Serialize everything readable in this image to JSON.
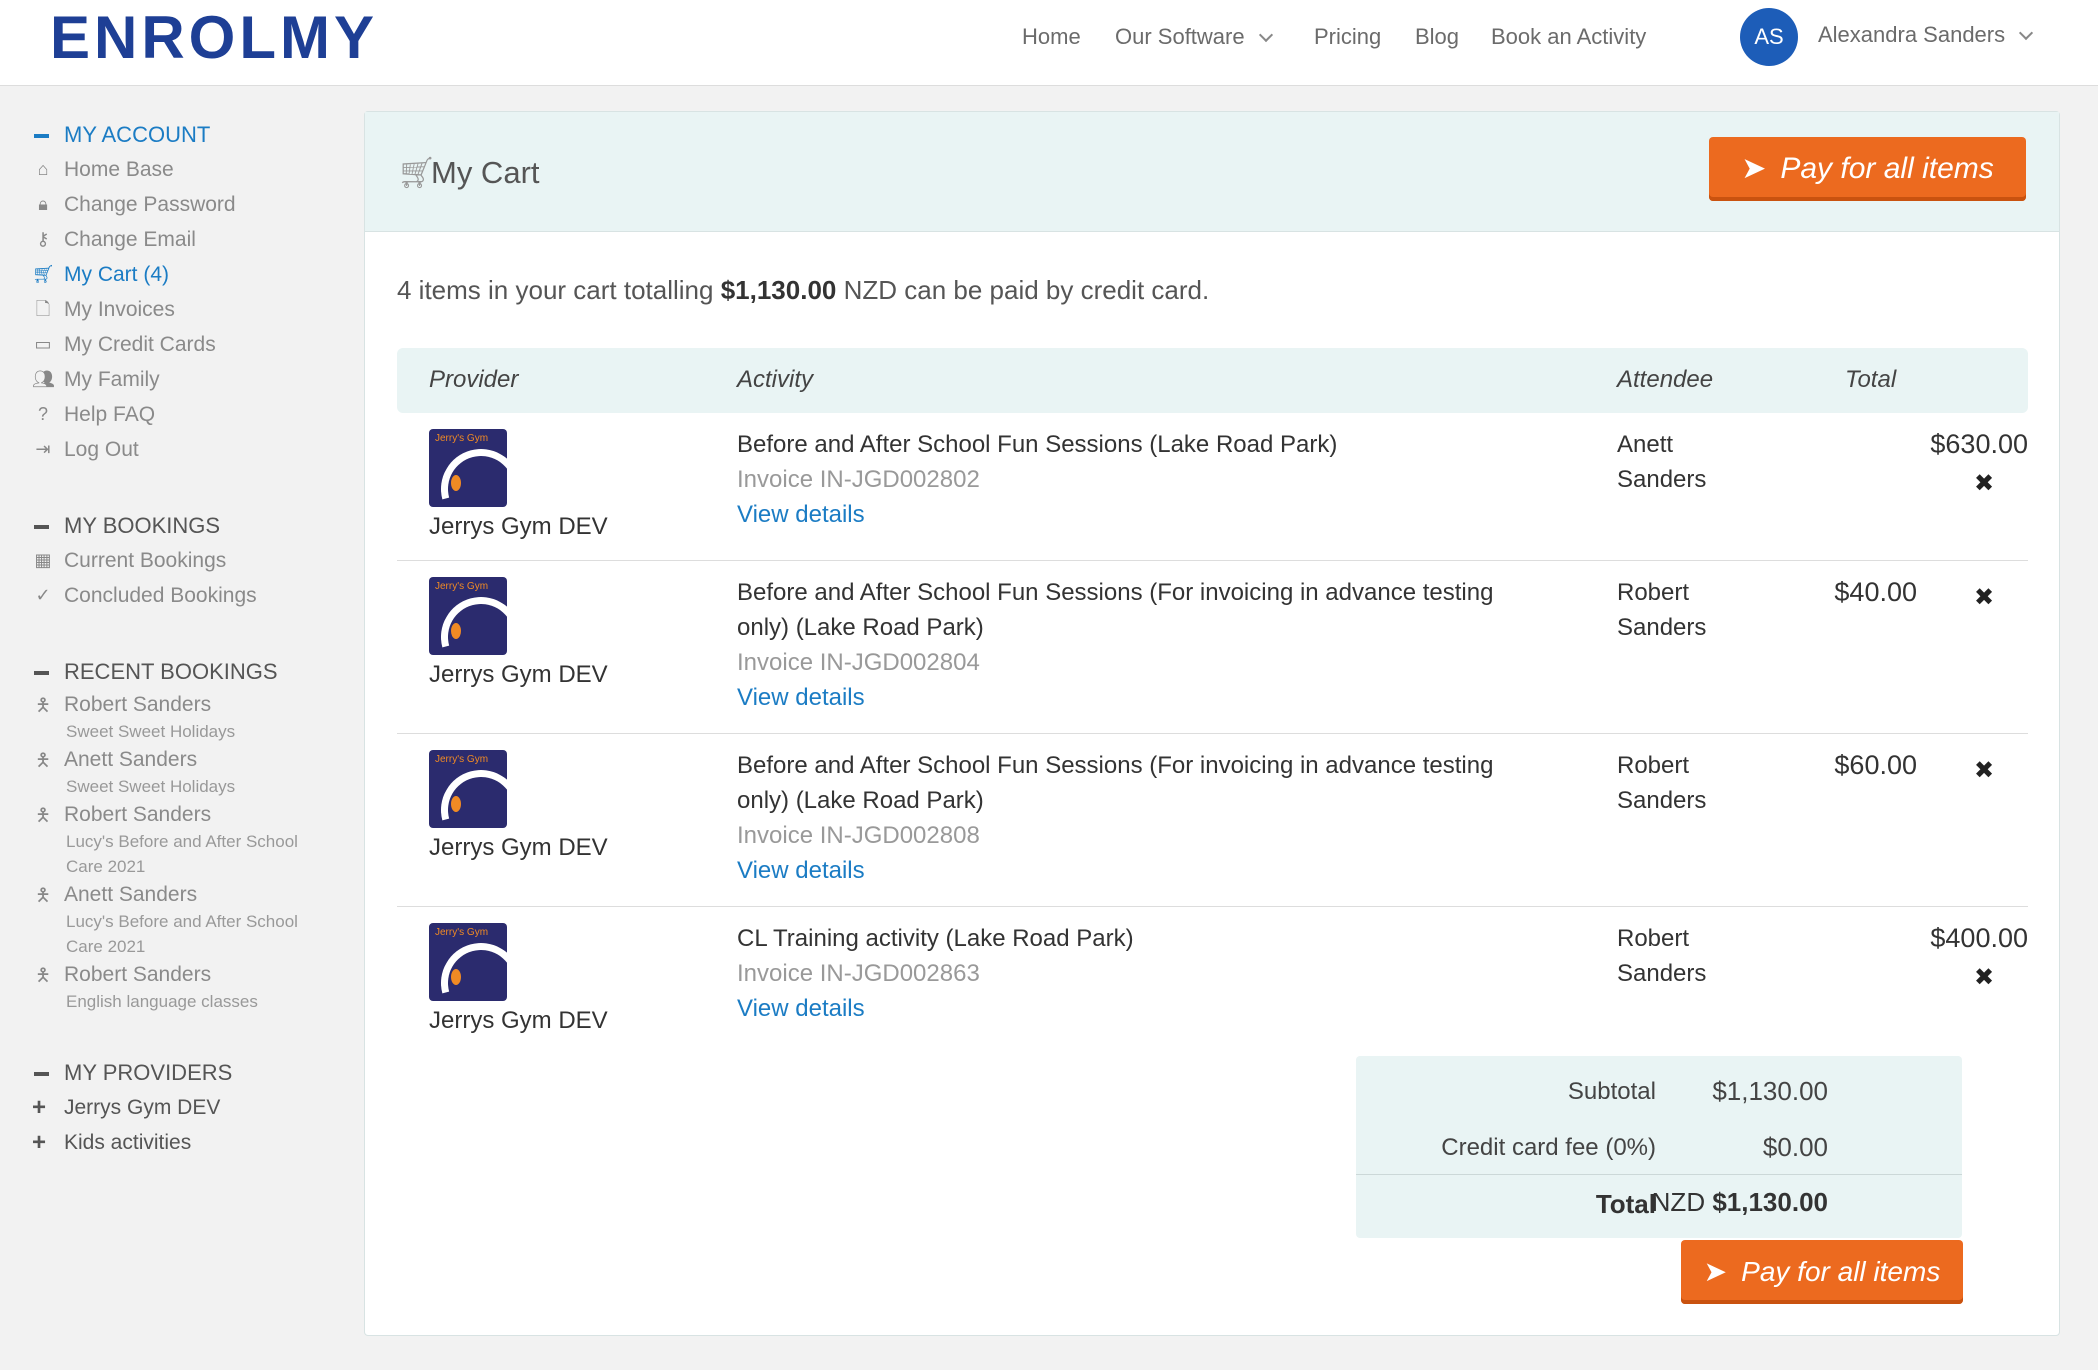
{
  "brand": {
    "logo_text": "ENROLMY"
  },
  "nav": {
    "items": [
      "Home",
      "Our Software",
      "Pricing",
      "Blog",
      "Book an Activity"
    ],
    "user_initials": "AS",
    "user_name": "Alexandra Sanders"
  },
  "sidebar": {
    "account_heading": "MY ACCOUNT",
    "account_items": [
      {
        "label": "Home Base",
        "icon": "home-icon"
      },
      {
        "label": "Change Password",
        "icon": "lock-icon"
      },
      {
        "label": "Change Email",
        "icon": "key-icon"
      },
      {
        "label": "My Cart (4)",
        "icon": "cart-icon"
      },
      {
        "label": "My Invoices",
        "icon": "file-icon"
      },
      {
        "label": "My Credit Cards",
        "icon": "credit-card-icon"
      },
      {
        "label": "My Family",
        "icon": "users-icon"
      },
      {
        "label": "Help FAQ",
        "icon": "question-icon"
      },
      {
        "label": "Log Out",
        "icon": "logout-icon"
      }
    ],
    "bookings_heading": "MY BOOKINGS",
    "bookings_items": [
      {
        "label": "Current Bookings",
        "icon": "calendar-icon"
      },
      {
        "label": "Concluded Bookings",
        "icon": "check-circle-icon"
      }
    ],
    "recent_heading": "RECENT BOOKINGS",
    "recent_items": [
      {
        "name": "Robert Sanders",
        "activity": "Sweet Sweet Holidays"
      },
      {
        "name": "Anett Sanders",
        "activity": "Sweet Sweet Holidays"
      },
      {
        "name": "Robert Sanders",
        "activity": "Lucy's Before and After School Care 2021"
      },
      {
        "name": "Anett Sanders",
        "activity": "Lucy's Before and After School Care 2021"
      },
      {
        "name": "Robert Sanders",
        "activity": "English language classes"
      }
    ],
    "providers_heading": "MY PROVIDERS",
    "providers_items": [
      "Jerrys Gym DEV",
      "Kids activities"
    ]
  },
  "cart": {
    "title": "My Cart",
    "pay_label": "Pay for all items",
    "summary_pre": "4 items in your cart totalling ",
    "summary_amount": "$1,130.00",
    "summary_post": " NZD can be paid by credit card.",
    "columns": [
      "Provider",
      "Activity",
      "Attendee",
      "Total"
    ],
    "rows": [
      {
        "provider": "Jerrys Gym DEV",
        "logo_text": "Jerry's Gym",
        "activity": "Before and After School Fun Sessions (Lake Road Park)",
        "invoice": "Invoice IN-JGD002802",
        "link": "View details",
        "attendee": "Anett Sanders",
        "total": "$630.00"
      },
      {
        "provider": "Jerrys Gym DEV",
        "logo_text": "Jerry's Gym",
        "activity": "Before and After School Fun Sessions (For invoicing in advance testing only) (Lake Road Park)",
        "invoice": "Invoice IN-JGD002804",
        "link": "View details",
        "attendee": "Robert Sanders",
        "total": "$40.00"
      },
      {
        "provider": "Jerrys Gym DEV",
        "logo_text": "Jerry's Gym",
        "activity": "Before and After School Fun Sessions (For invoicing in advance testing only) (Lake Road Park)",
        "invoice": "Invoice IN-JGD002808",
        "link": "View details",
        "attendee": "Robert Sanders",
        "total": "$60.00"
      },
      {
        "provider": "Jerrys Gym DEV",
        "logo_text": "Jerry's Gym",
        "activity": "CL Training activity (Lake Road Park)",
        "invoice": "Invoice IN-JGD002863",
        "link": "View details",
        "attendee": "Robert Sanders",
        "total": "$400.00"
      }
    ],
    "subtotal_label": "Subtotal",
    "subtotal_value": "$1,130.00",
    "fee_label": "Credit card fee (0%)",
    "fee_value": "$0.00",
    "total_label": "Total",
    "total_currency": "NZD",
    "total_value": "$1,130.00"
  },
  "colors": {
    "accent": "#1b7cc4",
    "button": "#ec6a1f",
    "brand": "#1e3f95",
    "panel": "#e9f4f4"
  }
}
